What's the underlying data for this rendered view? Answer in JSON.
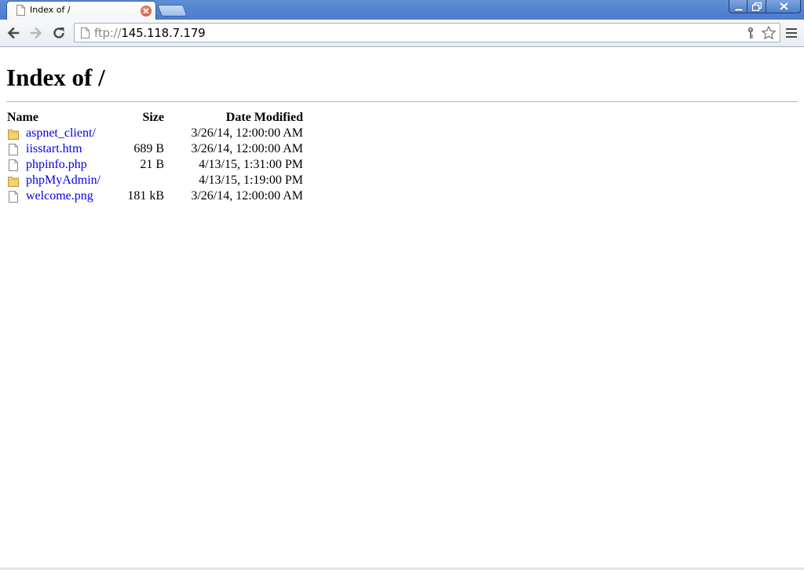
{
  "browser": {
    "tab": {
      "title": "Index of /"
    },
    "address": {
      "scheme": "ftp://",
      "host": "145.118.7.179"
    }
  },
  "page": {
    "heading": "Index of /",
    "columns": {
      "name": "Name",
      "size": "Size",
      "date": "Date Modified"
    },
    "entries": [
      {
        "name": "aspnet_client/",
        "size": "",
        "date": "3/26/14, 12:00:00 AM",
        "icon": "folder-icon"
      },
      {
        "name": "iisstart.htm",
        "size": "689 B",
        "date": "3/26/14, 12:00:00 AM",
        "icon": "file-icon"
      },
      {
        "name": "phpinfo.php",
        "size": "21 B",
        "date": "4/13/15, 1:31:00 PM",
        "icon": "file-icon"
      },
      {
        "name": "phpMyAdmin/",
        "size": "",
        "date": "4/13/15, 1:19:00 PM",
        "icon": "folder-icon"
      },
      {
        "name": "welcome.png",
        "size": "181 kB",
        "date": "3/26/14, 12:00:00 AM",
        "icon": "file-icon"
      }
    ]
  },
  "colors": {
    "link": "#0000ee",
    "titlebar": "#4b7bcb",
    "folder": "#f2c94c"
  }
}
